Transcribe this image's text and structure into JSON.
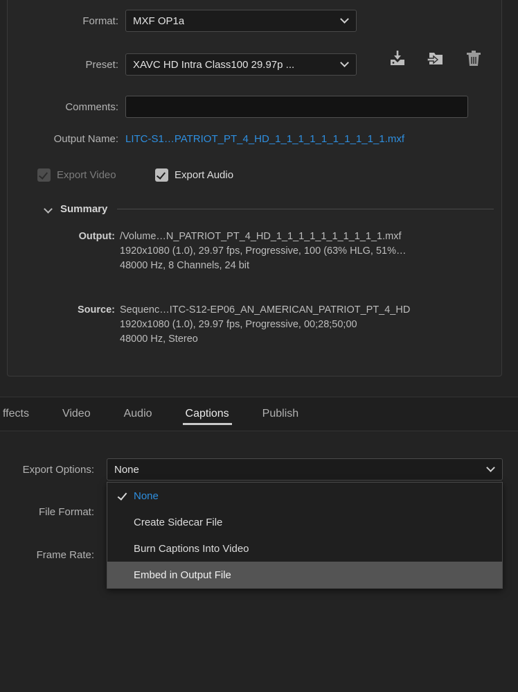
{
  "export_settings": {
    "format": {
      "label": "Format:",
      "value": "MXF OP1a"
    },
    "preset": {
      "label": "Preset:",
      "value": "XAVC HD Intra Class100 29.97p ...",
      "icons": [
        {
          "name": "import-preset-icon",
          "title": "Import Preset"
        },
        {
          "name": "export-preset-icon",
          "title": "Export Preset"
        },
        {
          "name": "delete-preset-icon",
          "title": "Delete Preset"
        }
      ]
    },
    "comments": {
      "label": "Comments:",
      "value": "",
      "placeholder": ""
    },
    "output_name": {
      "label": "Output Name:",
      "value": "LITC-S1…PATRIOT_PT_4_HD_1_1_1_1_1_1_1_1_1_1.mxf",
      "color": "#2e8fe0"
    },
    "checkboxes": [
      {
        "label": "Export Video",
        "checked": true,
        "enabled": false
      },
      {
        "label": "Export Audio",
        "checked": true,
        "enabled": true
      }
    ],
    "summary": {
      "title": "Summary",
      "output": {
        "key": "Output:",
        "lines": [
          "/Volume…N_PATRIOT_PT_4_HD_1_1_1_1_1_1_1_1_1_1.mxf",
          "1920x1080 (1.0), 29.97 fps, Progressive, 100 (63% HLG, 51%…",
          "48000 Hz, 8 Channels, 24 bit"
        ]
      },
      "source": {
        "key": "Source:",
        "lines": [
          "Sequenc…ITC-S12-EP06_AN_AMERICAN_PATRIOT_PT_4_HD",
          "1920x1080 (1.0), 29.97 fps, Progressive, 00;28;50;00",
          "48000 Hz, Stereo"
        ]
      }
    }
  },
  "tabs": [
    {
      "label": "ffects",
      "active": false
    },
    {
      "label": "Video",
      "active": false
    },
    {
      "label": "Audio",
      "active": false
    },
    {
      "label": "Captions",
      "active": true
    },
    {
      "label": "Publish",
      "active": false
    }
  ],
  "captions": {
    "export_options": {
      "label": "Export Options:",
      "value": "None"
    },
    "file_format": {
      "label": "File Format:"
    },
    "frame_rate": {
      "label": "Frame Rate:"
    },
    "dropdown_options": [
      {
        "label": "None",
        "selected": true,
        "highlighted": false
      },
      {
        "label": "Create Sidecar File",
        "selected": false,
        "highlighted": false
      },
      {
        "label": "Burn Captions Into Video",
        "selected": false,
        "highlighted": false
      },
      {
        "label": "Embed in Output File",
        "selected": false,
        "highlighted": true
      }
    ]
  },
  "colors": {
    "accent": "#2e8fe0",
    "panel_bg": "#262626",
    "app_bg": "#232323",
    "highlight": "#545454"
  }
}
